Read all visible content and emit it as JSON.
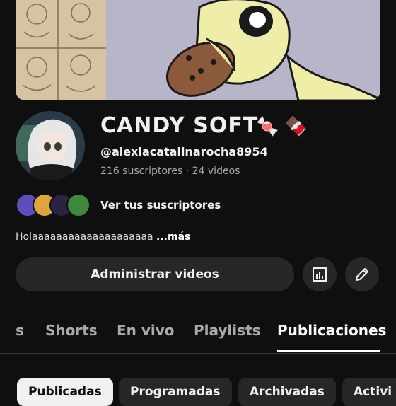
{
  "channel": {
    "name": "CANDY  SOFT",
    "name_emojis": [
      "🍬",
      "🍫"
    ],
    "handle": "@alexiacatalinarocha8954",
    "stats": "216 suscriptores · 24 videos",
    "subscribers_link": "Ver tus suscriptores",
    "description": "Holaaaaaaaaaaaaaaaaaaaa",
    "more_label": "...más"
  },
  "actions": {
    "manage_videos_label": "Administrar videos",
    "analytics_icon": "analytics-icon",
    "edit_icon": "pencil-icon"
  },
  "tabs": [
    "s",
    "Shorts",
    "En vivo",
    "Playlists",
    "Publicaciones"
  ],
  "active_tab": "Publicaciones",
  "chips": [
    "Publicadas",
    "Programadas",
    "Archivadas",
    "Activi"
  ],
  "active_chip": "Publicadas",
  "colors": {
    "background": "#0f0f0f",
    "surface": "#272727",
    "text": "#f1f1f1",
    "muted": "#aaaaaa"
  }
}
